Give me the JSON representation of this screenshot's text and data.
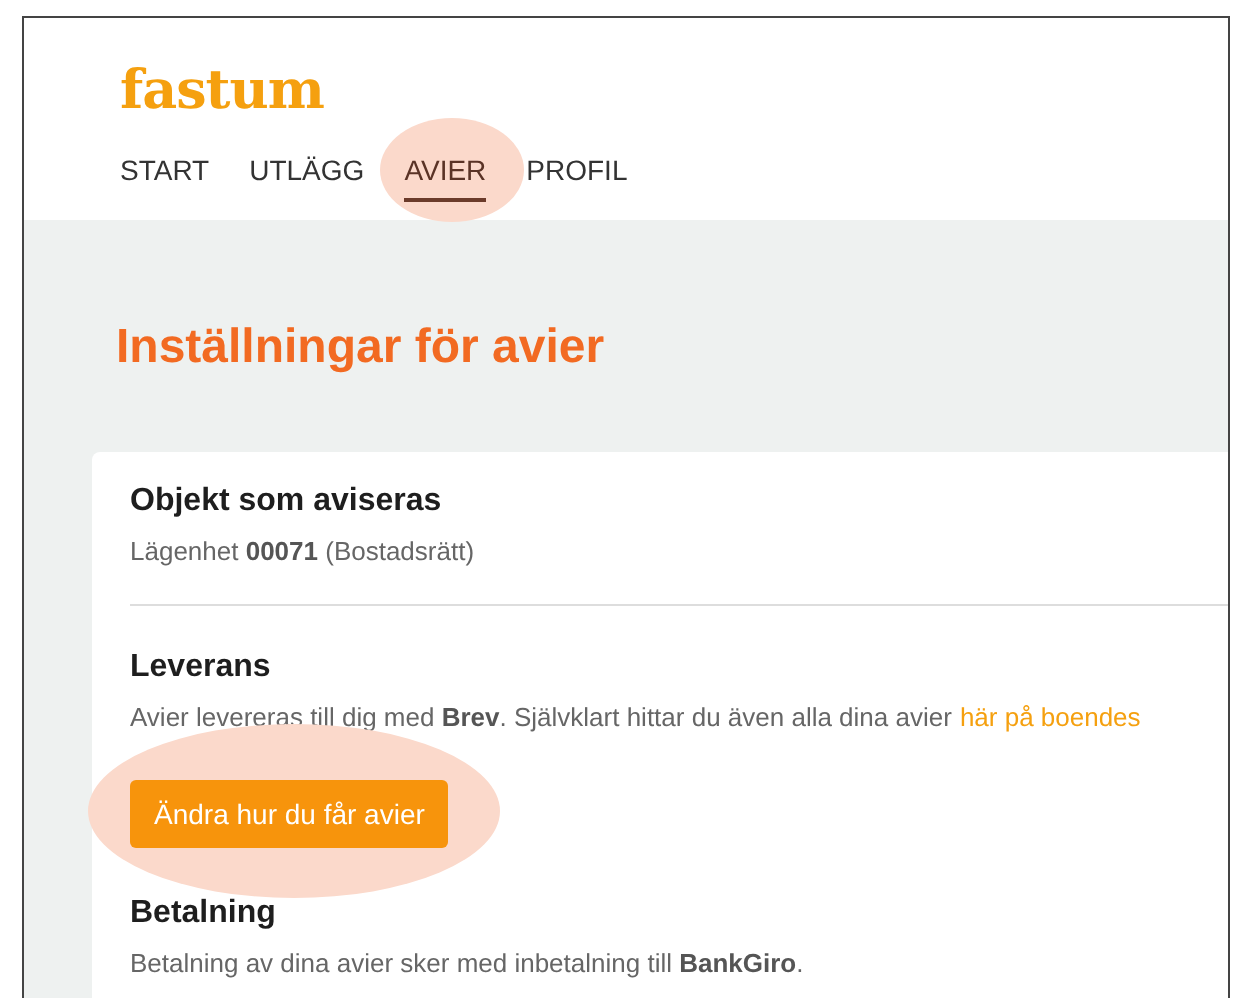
{
  "logo": "fastum",
  "nav": [
    {
      "label": "START",
      "selected": false,
      "highlighted": false
    },
    {
      "label": "UTLÄGG",
      "selected": false,
      "highlighted": false
    },
    {
      "label": "AVIER",
      "selected": true,
      "highlighted": true
    },
    {
      "label": "PROFIL",
      "selected": false,
      "highlighted": false
    }
  ],
  "page_title": "Inställningar för avier",
  "sections": [
    {
      "heading": "Objekt som aviseras",
      "text": "Lägenhet **00071** (Bostadsrätt)"
    },
    {
      "heading": "Leverans",
      "text": "Avier levereras till dig med **Brev**. Självklart hittar du även alla dina avier",
      "link": "här på boendes",
      "button": {
        "label": "Ändra hur du får avier",
        "highlighted": true
      }
    },
    {
      "heading": "Betalning",
      "text": "Betalning av dina avier sker med inbetalning till **BankGiro**."
    }
  ]
}
